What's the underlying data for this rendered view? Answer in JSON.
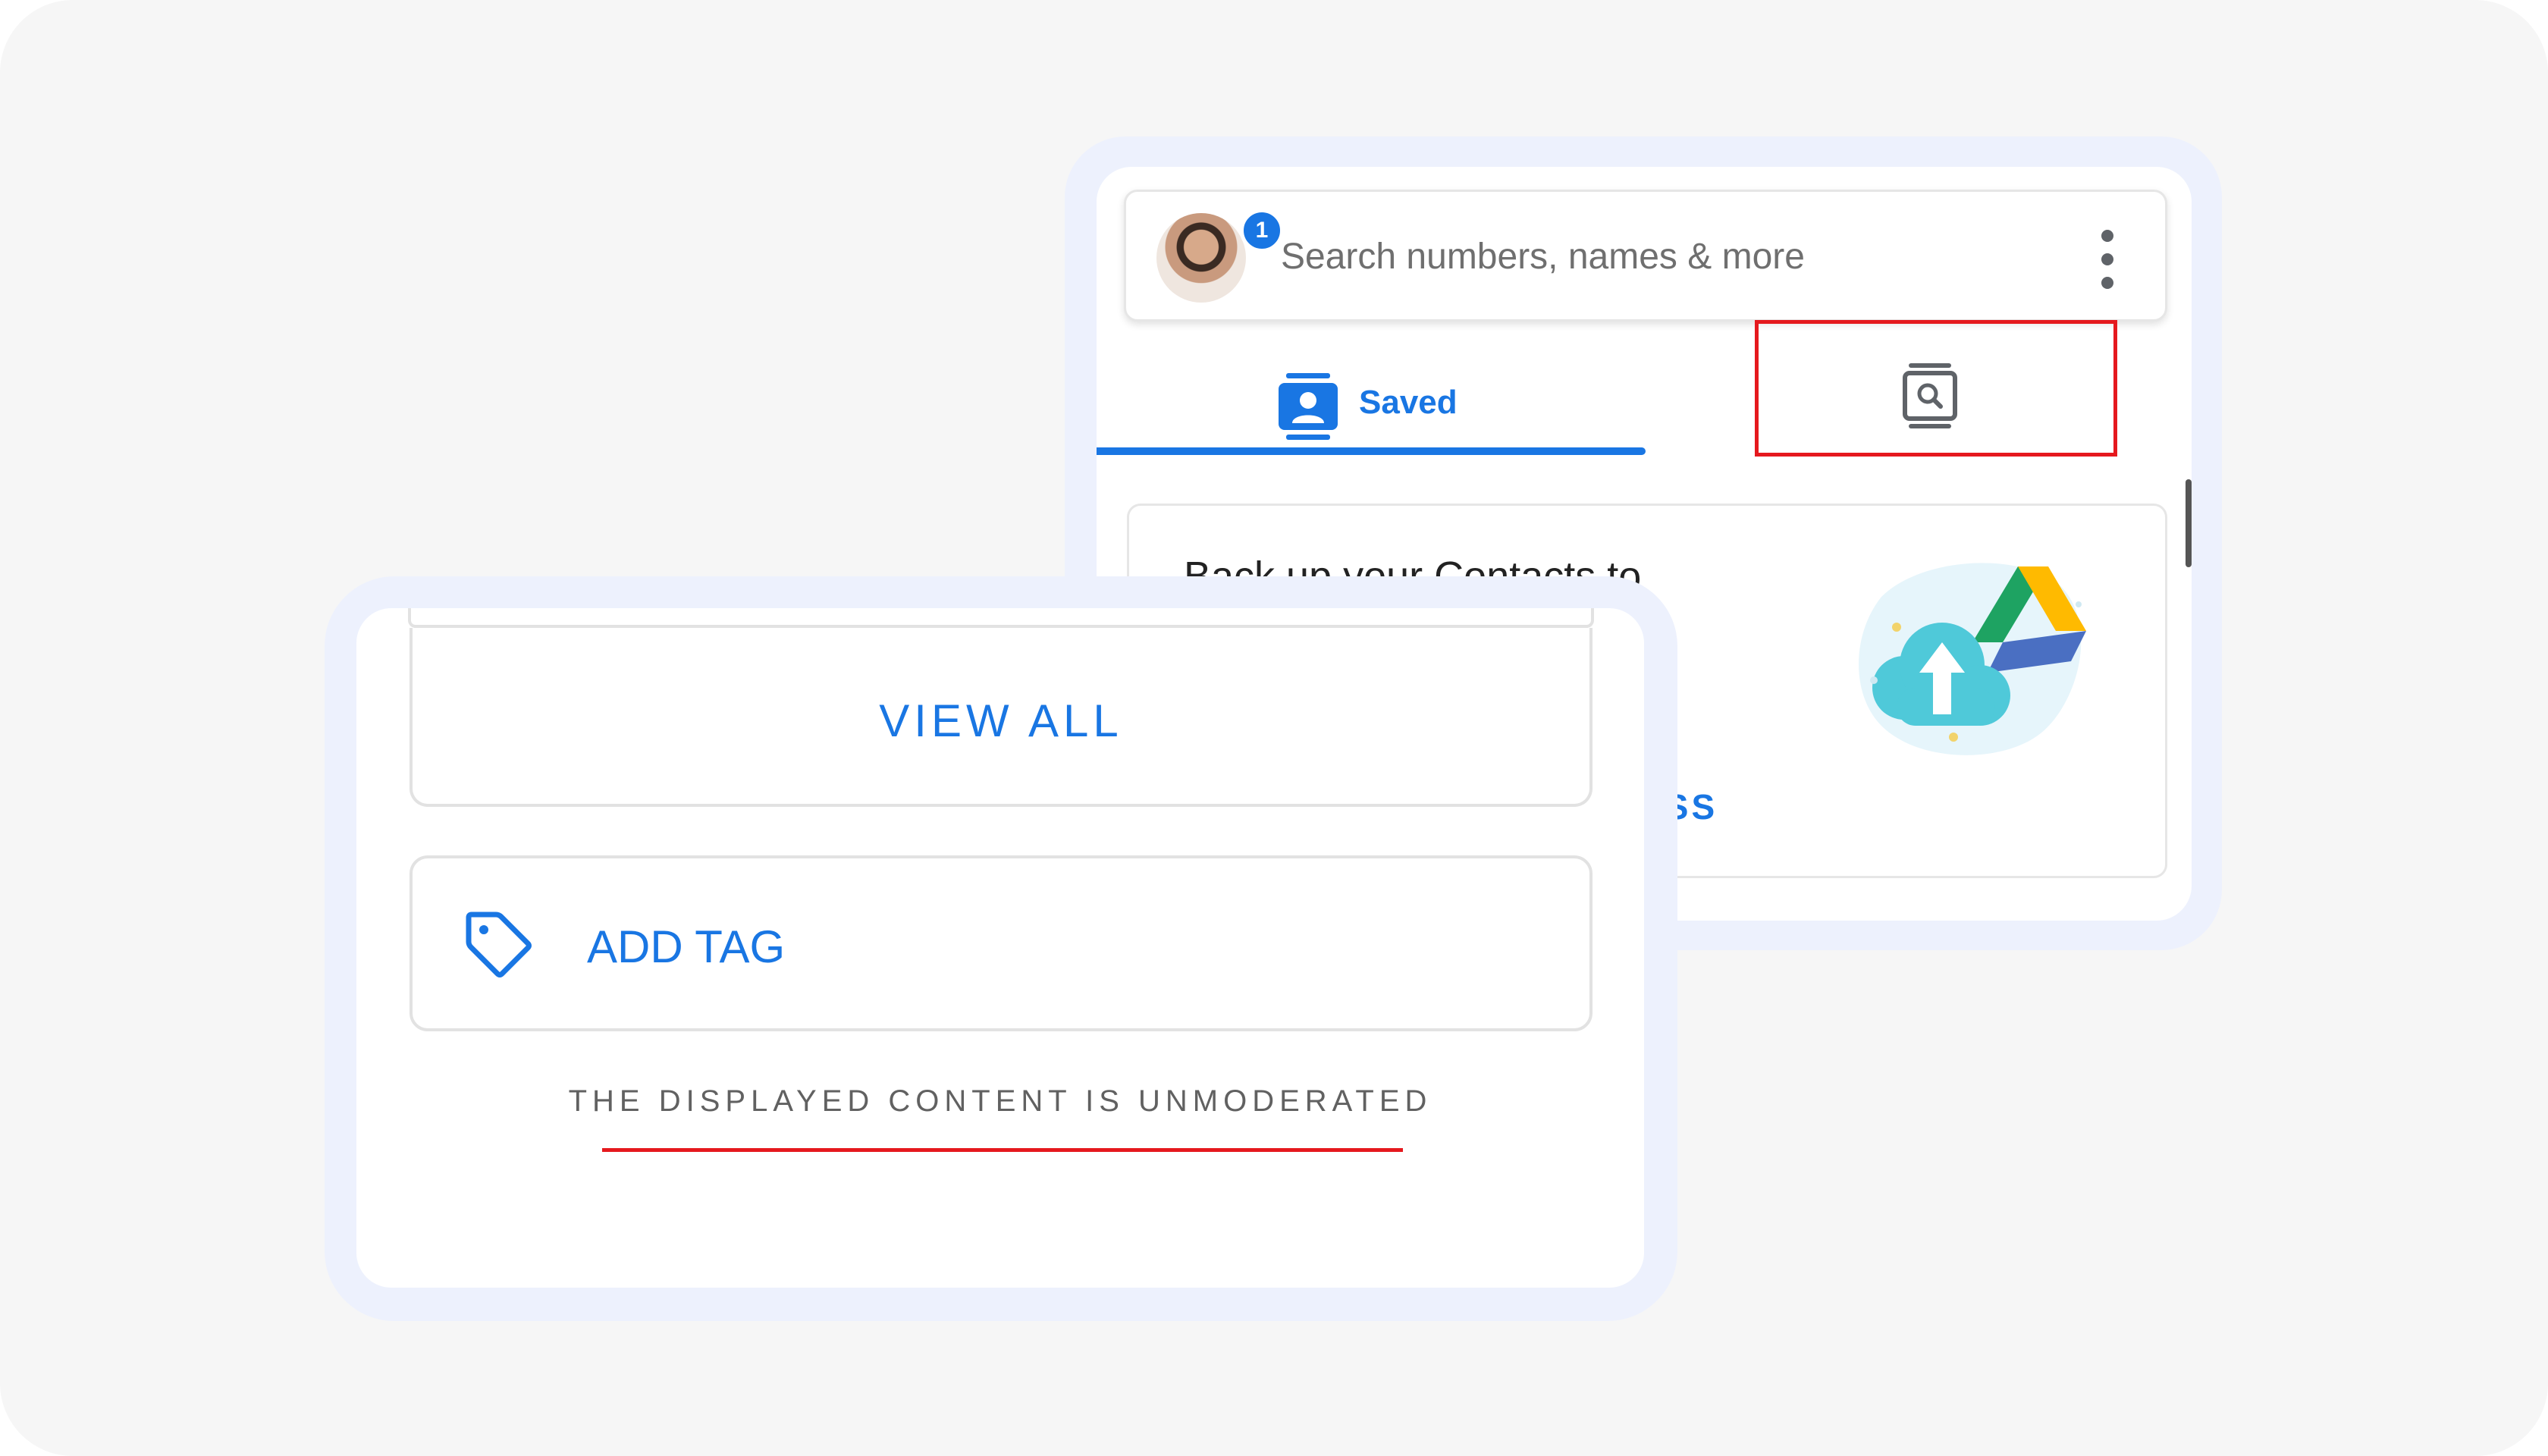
{
  "search": {
    "placeholder": "Search numbers, names & more",
    "notification_count": "1",
    "menu_icon": "more-vert-icon",
    "avatar_icon": "user-avatar"
  },
  "tabs": [
    {
      "label": "Saved",
      "icon": "contacts-icon",
      "active": true
    },
    {
      "label": "",
      "icon": "contact-search-icon",
      "active": false,
      "highlighted": true
    }
  ],
  "backup_card": {
    "title": "Back up your Contacts to",
    "action": "ISS",
    "art": "cloud-upload-drive-illustration"
  },
  "front": {
    "view_all_label": "VIEW ALL",
    "add_tag_label": "ADD TAG",
    "tag_icon": "tag-icon",
    "disclaimer": "THE DISPLAYED CONTENT IS UNMODERATED"
  },
  "colors": {
    "accent": "#1976e3",
    "highlight_red": "#e5191e",
    "frame": "#edf1fd",
    "background": "#f6f6f6"
  }
}
